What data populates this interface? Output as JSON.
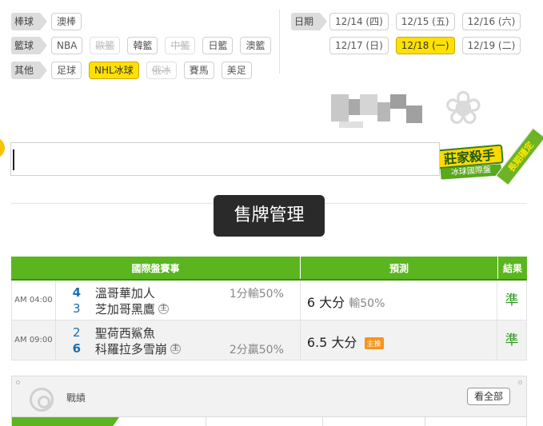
{
  "filters": {
    "rows": [
      {
        "category": "棒球",
        "chips": [
          {
            "label": "澳棒",
            "state": "normal"
          }
        ]
      },
      {
        "category": "籃球",
        "chips": [
          {
            "label": "NBA",
            "state": "normal"
          },
          {
            "label": "歐籃",
            "state": "disabled"
          },
          {
            "label": "韓籃",
            "state": "normal"
          },
          {
            "label": "中籃",
            "state": "disabled"
          },
          {
            "label": "日籃",
            "state": "normal"
          },
          {
            "label": "澳籃",
            "state": "normal"
          }
        ]
      },
      {
        "category": "其他",
        "chips": [
          {
            "label": "足球",
            "state": "normal"
          },
          {
            "label": "NHL冰球",
            "state": "selected"
          },
          {
            "label": "俄冰",
            "state": "disabled"
          },
          {
            "label": "賽馬",
            "state": "normal"
          },
          {
            "label": "美足",
            "state": "normal"
          }
        ]
      }
    ],
    "date_label": "日期",
    "dates_row1": [
      {
        "label": "12/14 (四)",
        "state": "normal"
      },
      {
        "label": "12/15 (五)",
        "state": "normal"
      },
      {
        "label": "12/16 (六)",
        "state": "normal"
      }
    ],
    "dates_row2": [
      {
        "label": "12/17 (日)",
        "state": "normal"
      },
      {
        "label": "12/18 (一)",
        "state": "selected"
      },
      {
        "label": "12/19 (二)",
        "state": "normal"
      }
    ]
  },
  "ad": {
    "title": "莊家殺手",
    "subtitle": "冰球國際盤",
    "ribbon": "長期穩定"
  },
  "toast": "售牌管理",
  "table": {
    "headers": {
      "event": "國際盤賽事",
      "prediction": "預測",
      "result": "結果"
    },
    "rows": [
      {
        "time": "AM 04:00",
        "away_score": "4",
        "away": "溫哥華加人",
        "home_score": "3",
        "home": "芝加哥黑鷹",
        "home_mark": "主",
        "handicap": "1分輸50%",
        "prediction": "6 大分",
        "prediction_result": "輸50%",
        "tag": "",
        "result": "準"
      },
      {
        "time": "AM 09:00",
        "away_score": "2",
        "away": "聖荷西鯊魚",
        "home_score": "6",
        "home": "科羅拉多雪崩",
        "home_mark": "主",
        "handicap": "2分贏50%",
        "prediction": "6.5 大分",
        "prediction_result": "",
        "tag": "主推",
        "result": "準"
      }
    ]
  },
  "stats": {
    "label": "戰績",
    "view_all": "看全部"
  },
  "colors": {
    "accent_green": "#5ab51f",
    "selected_yellow": "#ffe100",
    "score_blue": "#1a6fb3"
  }
}
